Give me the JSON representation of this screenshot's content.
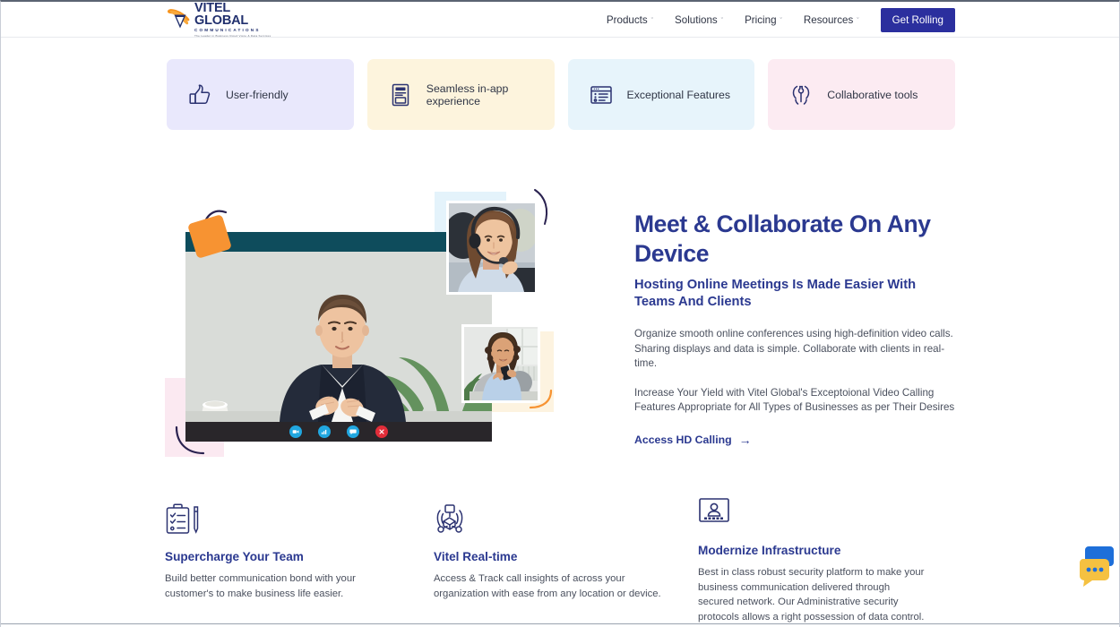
{
  "brand": {
    "logo_main": "VITEL GLOBAL",
    "logo_sub": "COMMUNICATIONS",
    "logo_tagline": "The Leader in Business Cloud Voice & Data Services",
    "logo_icon": "vitel-global-swoosh-logo",
    "navy": "#2b3990",
    "cta_navy": "#2b2f9e",
    "orange": "#f79332",
    "teal": "#0e4c5c"
  },
  "nav": {
    "items": [
      {
        "label": "Products",
        "caret": "ˇ"
      },
      {
        "label": "Solutions",
        "caret": "ˇ"
      },
      {
        "label": "Pricing",
        "caret": "ˇ"
      },
      {
        "label": "Resources",
        "caret": "ˇ"
      }
    ],
    "cta_label": "Get Rolling"
  },
  "pills": [
    {
      "label": "User-friendly",
      "icon": "thumbs-up-icon",
      "bg": "#e9e8fc"
    },
    {
      "label": "Seamless in-app experience",
      "icon": "app-window-document-icon",
      "bg": "#fdf4dd"
    },
    {
      "label": "Exceptional Features",
      "icon": "browser-list-icon",
      "bg": "#e7f4fb"
    },
    {
      "label": "Collaborative tools",
      "icon": "gear-wrench-icon",
      "bg": "#fcebf2"
    }
  ],
  "hero": {
    "heading": "Meet & Collaborate On Any Device",
    "subheading": "Hosting Online Meetings Is Made Easier With Teams And Clients",
    "paragraph_1": "Organize smooth online conferences using high-definition video calls. Sharing displays and data is simple. Collaborate with clients in real-time.",
    "paragraph_2": "Increase Your Yield with Vitel Global's Exceptoional Video Calling Features Appropriate for All Types of Businesses as per Their Desires",
    "link_label": "Access HD Calling",
    "link_arrow": "→",
    "visual": {
      "main_window_alt": "man-in-suit-on-video-call",
      "thumbnail_1_alt": "woman-with-headset-on-call",
      "thumbnail_2_alt": "woman-on-sofa-using-smartphone",
      "controls": [
        {
          "name": "camera-button",
          "icon": "video-camera-icon",
          "color": "#21a7e0"
        },
        {
          "name": "signal-button",
          "icon": "signal-bars-icon",
          "color": "#21a7e0"
        },
        {
          "name": "chat-button",
          "icon": "chat-bubble-icon",
          "color": "#21a7e0"
        },
        {
          "name": "end-call-button",
          "icon": "close-x-icon",
          "color": "#e12d39"
        }
      ]
    }
  },
  "features": [
    {
      "title": "Supercharge Your Team",
      "desc": "Build better communication bond with your customer's to make business life easier.",
      "icon": "clipboard-checklist-pencil-icon"
    },
    {
      "title": "Vitel Real-time",
      "desc": "Access & Track call insights of across your organization with ease from any location or device.",
      "icon": "realtime-broadcast-handshake-icon"
    },
    {
      "title": "Modernize Infrastructure",
      "desc": "Best in class robust security platform to make your business communication delivered through secured network. Our Administrative security protocols allows a right possession of data control.",
      "icon": "user-server-screen-icon"
    }
  ],
  "chat_widget": {
    "name": "live-chat-launcher",
    "icon": "chat-bubbles-ellipsis-icon",
    "blue": "#1e6fd9",
    "yellow": "#f5c141"
  }
}
